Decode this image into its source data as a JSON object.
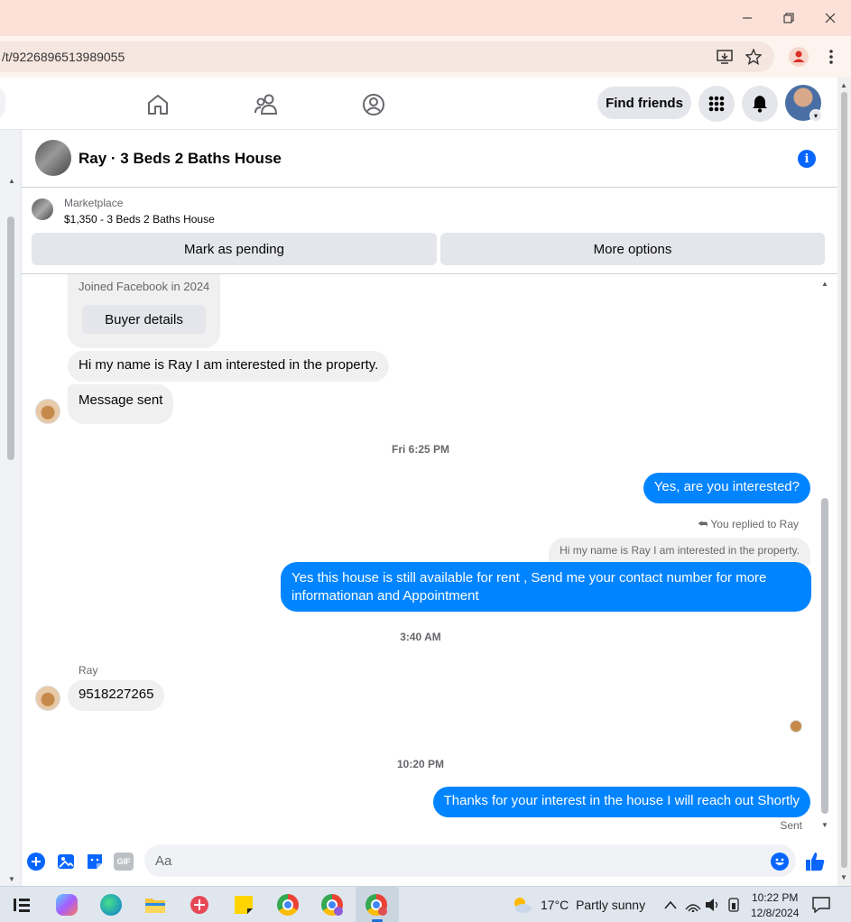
{
  "browser": {
    "url": "/t/9226896513989055",
    "window_controls": [
      "minimize-icon",
      "restore-icon",
      "close-icon"
    ]
  },
  "nav": {
    "find_friends_label": "Find friends"
  },
  "chat": {
    "title": "Ray · 3 Beds 2 Baths House",
    "marketplace_label": "Marketplace",
    "listing": "$1,350 - 3 Beds 2 Baths House",
    "mark_pending_label": "Mark as pending",
    "more_options_label": "More options"
  },
  "messages": {
    "joined": "Joined Facebook in 2024",
    "buyer_details_label": "Buyer details",
    "m1": "Hi my name is Ray I am interested in the property.",
    "m2": "Message sent",
    "ts1": "Fri 6:25 PM",
    "m3": "Yes, are you interested?",
    "replied_label": "You replied to Ray",
    "quoted": "Hi my name is Ray I am interested in the property.",
    "m4": "Yes this house is still available for rent , Send me your contact number for more informationan and Appointment",
    "ts2": "3:40 AM",
    "sender_name": "Ray",
    "m5": "9518227265",
    "ts3": "10:20 PM",
    "m6": "Thanks for your interest in the house I will reach out Shortly",
    "status": "Sent"
  },
  "composer": {
    "placeholder": "Aa",
    "gif_label": "GIF"
  },
  "taskbar": {
    "temperature": "17°C",
    "weather": "Partly sunny",
    "time": "10:22 PM",
    "date": "12/8/2024"
  },
  "colors": {
    "accent": "#0084ff",
    "fb_blue": "#0866ff",
    "titlebar": "#fbe1d8"
  }
}
